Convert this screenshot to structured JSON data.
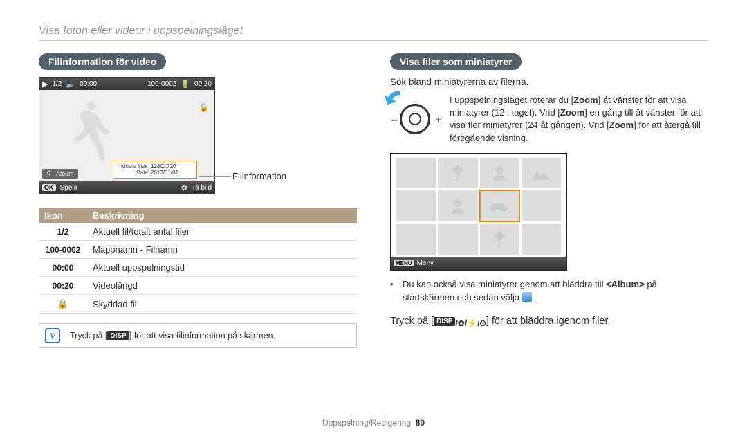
{
  "page_header": "Visa foton eller videor i uppspelningsläget",
  "left": {
    "heading": "Filinformation för video",
    "callout": "Filinformation",
    "screen": {
      "counter": "1/2",
      "time_cur": "00:00",
      "folder": "100-0002",
      "battery_icon": "battery-icon",
      "time_len": "00:20",
      "movie_size_k": "Movie Size",
      "movie_size_v": "1280X720",
      "date_k": "Date",
      "date_v": "2013/01/01",
      "album_chip": "Album",
      "ok_label": "OK",
      "play_label": "Spela",
      "capture_label": "Ta bild"
    },
    "table": {
      "hdr_icon": "Ikon",
      "hdr_desc": "Beskrivning",
      "rows": [
        {
          "icon": "1/2",
          "desc": "Aktuell fil/totalt antal filer"
        },
        {
          "icon": "100-0002",
          "desc": "Mappnamn - Filnamn"
        },
        {
          "icon": "00:00",
          "desc": "Aktuell uppspelningstid"
        },
        {
          "icon": "00:20",
          "desc": "Videolängd"
        },
        {
          "icon": "🔒",
          "desc": "Skyddad fil"
        }
      ]
    },
    "note_pre": "Tryck på [",
    "note_disp": "DISP",
    "note_post": "] för att visa filinformation på skärmen."
  },
  "right": {
    "heading": "Visa filer som miniatyrer",
    "sub": "Sök bland miniatyrerna av filerna.",
    "zoom_text_pre1": "I uppspelningsläget roterar du [",
    "zoom_text_b1": "Zoom",
    "zoom_text_mid1": "] åt vänster för att visa miniatyrer (12 i taget). Vrid [",
    "zoom_text_b2": "Zoom",
    "zoom_text_mid2": "] en gång till åt vänster för att visa fler miniatyrer (24 åt gången). Vrid [",
    "zoom_text_b3": "Zoom",
    "zoom_text_post": "] för att återgå till föregående visning.",
    "thumb_menu_chip": "MENU",
    "thumb_menu_label": "Meny",
    "bullet_pre": "Du kan också visa miniatyrer genom att bläddra till ",
    "bullet_album": "<Album>",
    "bullet_mid": " på startskärmen och sedan välja ",
    "bullet_post": ".",
    "scroll_pre": "Tryck på [",
    "scroll_disp": "DISP",
    "scroll_post": "] för att bläddra igenom filer."
  },
  "footer": {
    "section": "Uppspelning/Redigering",
    "page": "80"
  }
}
